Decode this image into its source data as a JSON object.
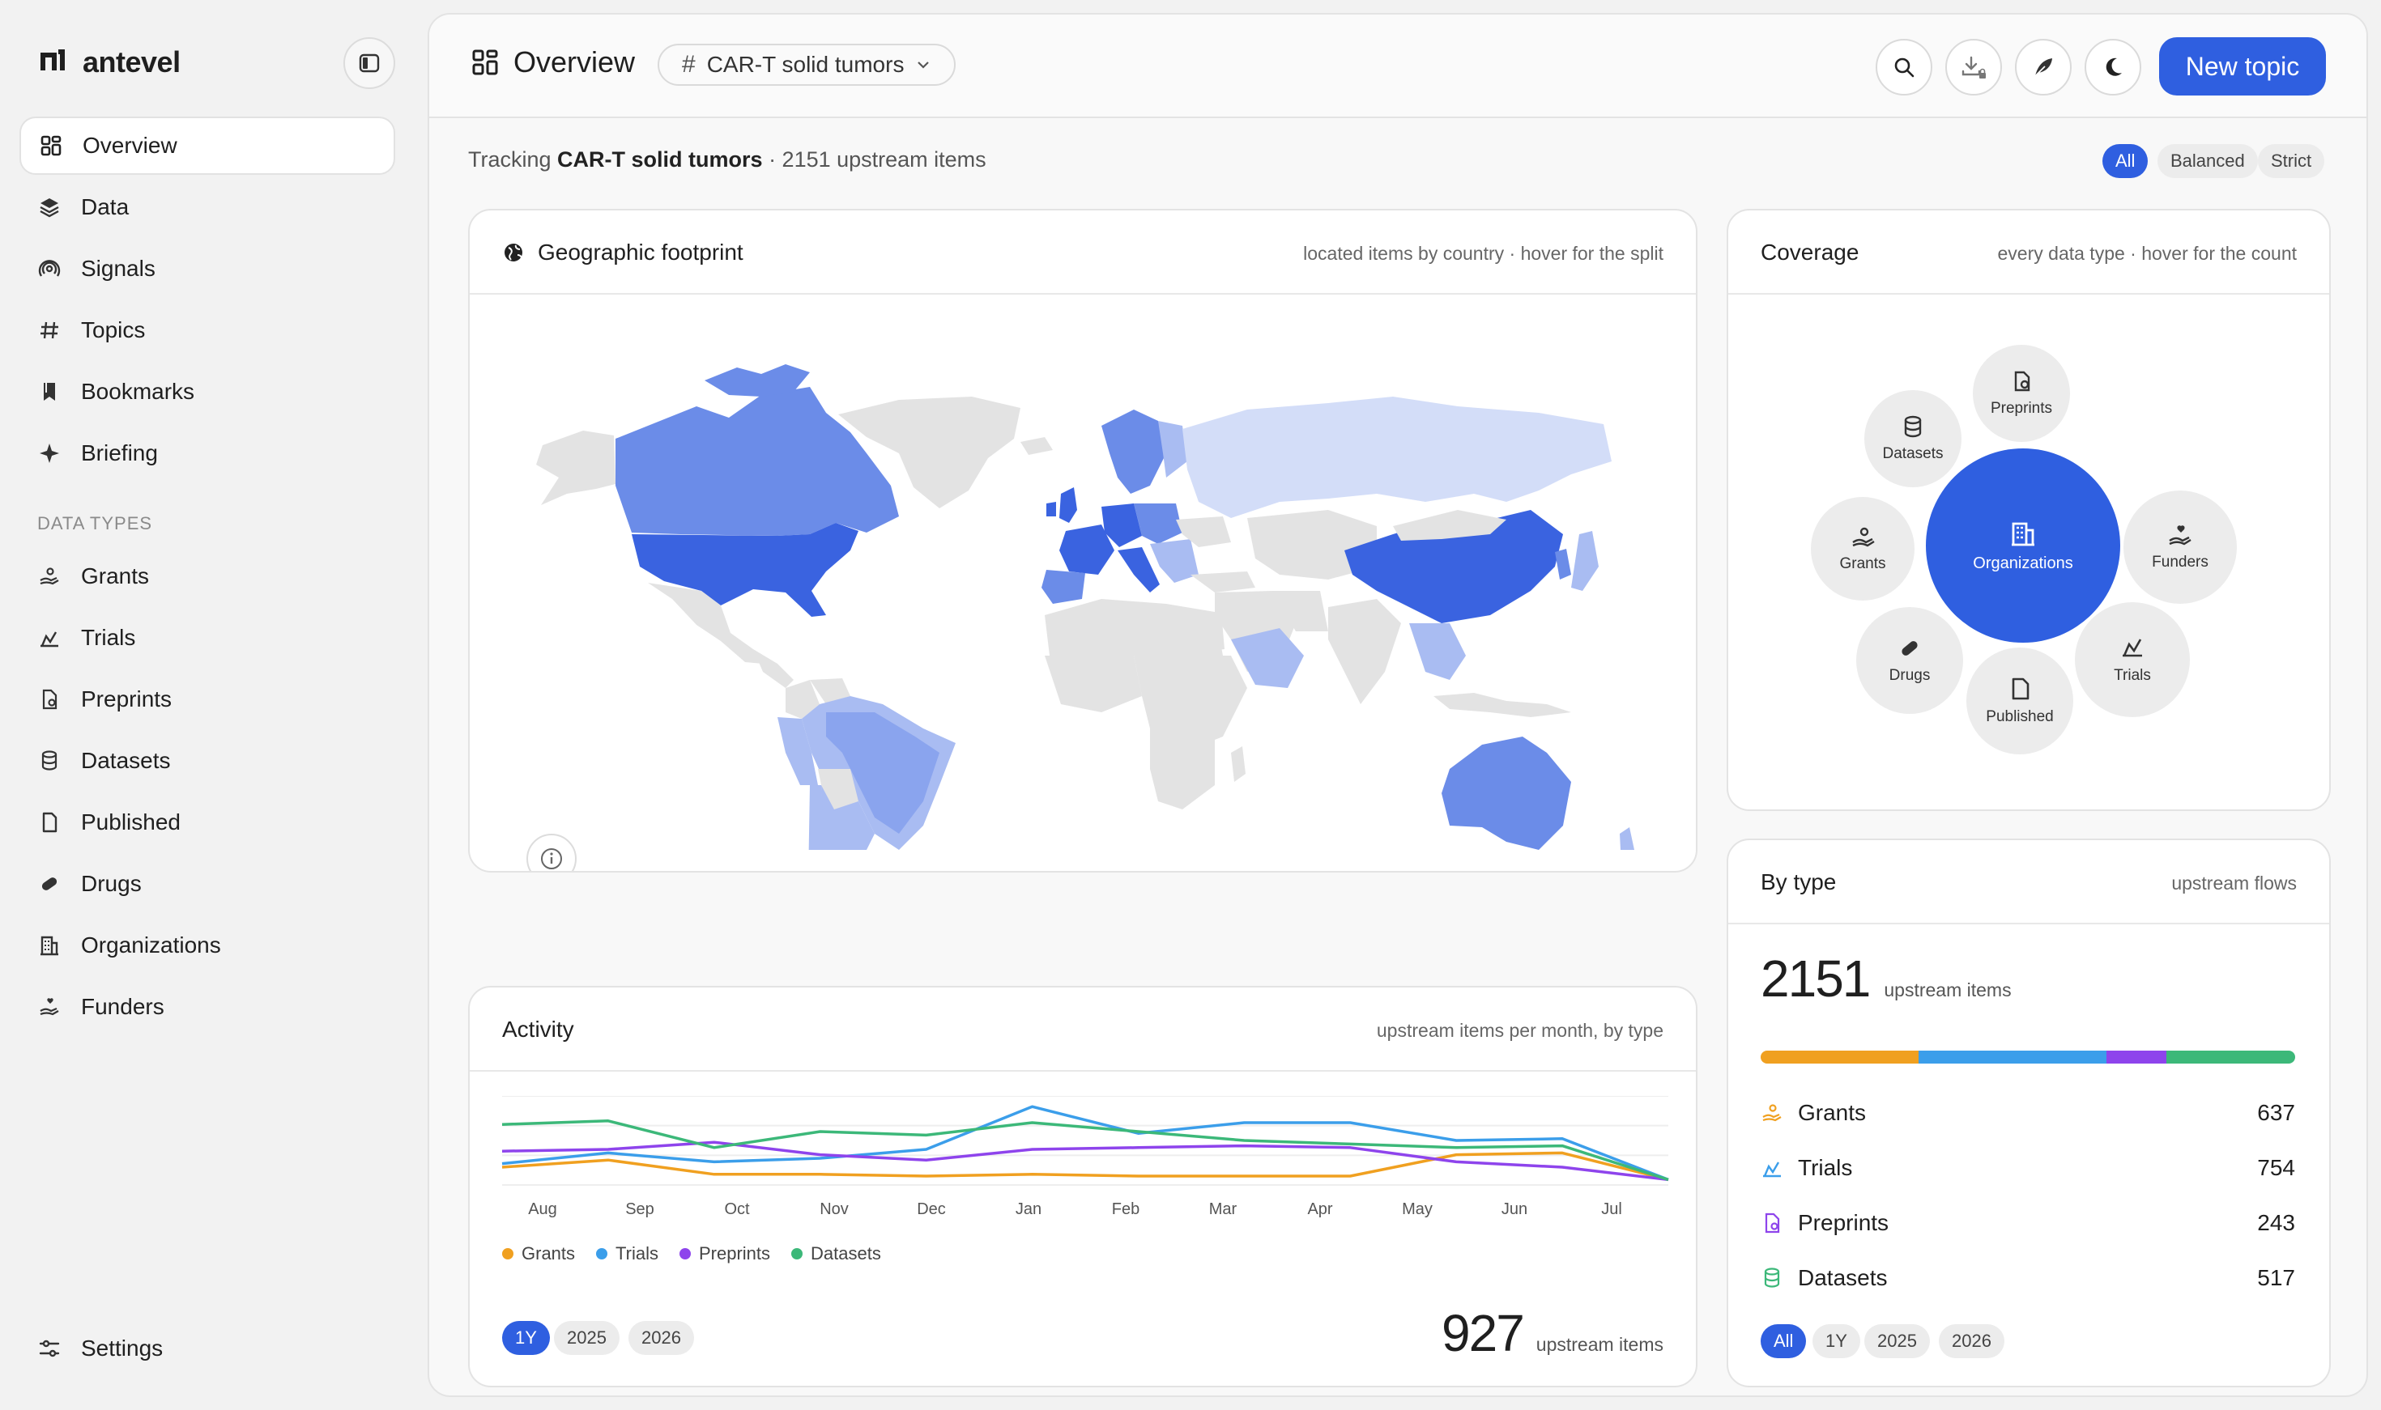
{
  "app": {
    "name": "antevel"
  },
  "sidebar": {
    "main_items": [
      {
        "label": "Overview",
        "icon": "grid-icon"
      },
      {
        "label": "Data",
        "icon": "layers-icon"
      },
      {
        "label": "Signals",
        "icon": "signal-icon"
      },
      {
        "label": "Topics",
        "icon": "hash-icon"
      },
      {
        "label": "Bookmarks",
        "icon": "bookmark-icon"
      },
      {
        "label": "Briefing",
        "icon": "sparkle-icon"
      }
    ],
    "section_label": "DATA TYPES",
    "type_items": [
      {
        "label": "Grants",
        "icon": "hand-coins-icon"
      },
      {
        "label": "Trials",
        "icon": "trial-icon"
      },
      {
        "label": "Preprints",
        "icon": "preprint-icon"
      },
      {
        "label": "Datasets",
        "icon": "database-icon"
      },
      {
        "label": "Published",
        "icon": "document-icon"
      },
      {
        "label": "Drugs",
        "icon": "pill-icon"
      },
      {
        "label": "Organizations",
        "icon": "building-icon"
      },
      {
        "label": "Funders",
        "icon": "funder-icon"
      }
    ],
    "settings_label": "Settings"
  },
  "header": {
    "title": "Overview",
    "topic_chip": "CAR-T solid tumors",
    "new_topic_label": "New topic"
  },
  "tracking": {
    "prefix": "Tracking",
    "topic": "CAR-T solid tumors",
    "suffix": "· 2151 upstream items"
  },
  "mode_filter": {
    "options": [
      "All",
      "Balanced",
      "Strict"
    ],
    "selected": "All"
  },
  "geo_card": {
    "title": "Geographic footprint",
    "subtitle": "located items by country · hover for the split"
  },
  "coverage_card": {
    "title": "Coverage",
    "subtitle": "every data type · hover for the count",
    "center": "Organizations",
    "bubbles": [
      "Preprints",
      "Datasets",
      "Grants",
      "Funders",
      "Drugs",
      "Trials",
      "Published"
    ]
  },
  "activity_card": {
    "title": "Activity",
    "subtitle": "upstream items per month, by type",
    "total": "927",
    "total_label": "upstream items",
    "ranges": [
      "1Y",
      "2025",
      "2026"
    ],
    "selected_range": "1Y"
  },
  "chart_data": {
    "type": "line",
    "x": [
      "Aug",
      "Sep",
      "Oct",
      "Nov",
      "Dec",
      "Jan",
      "Feb",
      "Mar",
      "Apr",
      "May",
      "Jun",
      "Jul"
    ],
    "series": [
      {
        "name": "Grants",
        "color": "#f0a020",
        "values": [
          10,
          14,
          6,
          6,
          5,
          6,
          5,
          5,
          5,
          17,
          18,
          3
        ]
      },
      {
        "name": "Trials",
        "color": "#3b9eea",
        "values": [
          12,
          18,
          13,
          15,
          20,
          44,
          29,
          35,
          35,
          25,
          26,
          3
        ]
      },
      {
        "name": "Preprints",
        "color": "#8e44ec",
        "values": [
          19,
          20,
          24,
          17,
          14,
          20,
          21,
          22,
          21,
          13,
          10,
          3
        ]
      },
      {
        "name": "Datasets",
        "color": "#3cb879",
        "values": [
          34,
          36,
          21,
          30,
          28,
          35,
          30,
          25,
          23,
          21,
          22,
          3
        ]
      }
    ],
    "ylim": [
      0,
      50
    ]
  },
  "bytype_card": {
    "title": "By type",
    "subtitle": "upstream flows",
    "total": "2151",
    "total_label": "upstream items",
    "rows": [
      {
        "label": "Grants",
        "value": "637",
        "color": "#f0a020",
        "icon": "hand-coins-icon"
      },
      {
        "label": "Trials",
        "value": "754",
        "color": "#3b9eea",
        "icon": "trial-icon"
      },
      {
        "label": "Preprints",
        "value": "243",
        "color": "#8e44ec",
        "icon": "preprint-icon"
      },
      {
        "label": "Datasets",
        "value": "517",
        "color": "#3cb879",
        "icon": "database-icon"
      }
    ],
    "ranges": [
      "All",
      "1Y",
      "2025",
      "2026"
    ],
    "selected_range": "All"
  },
  "colors": {
    "accent": "#2f5fe0",
    "map_high": "#3a63e0",
    "map_mid": "#6b8ce8",
    "map_low": "#a9bcf2",
    "map_faint": "#d3ddf8",
    "map_none": "#e3e3e3"
  }
}
